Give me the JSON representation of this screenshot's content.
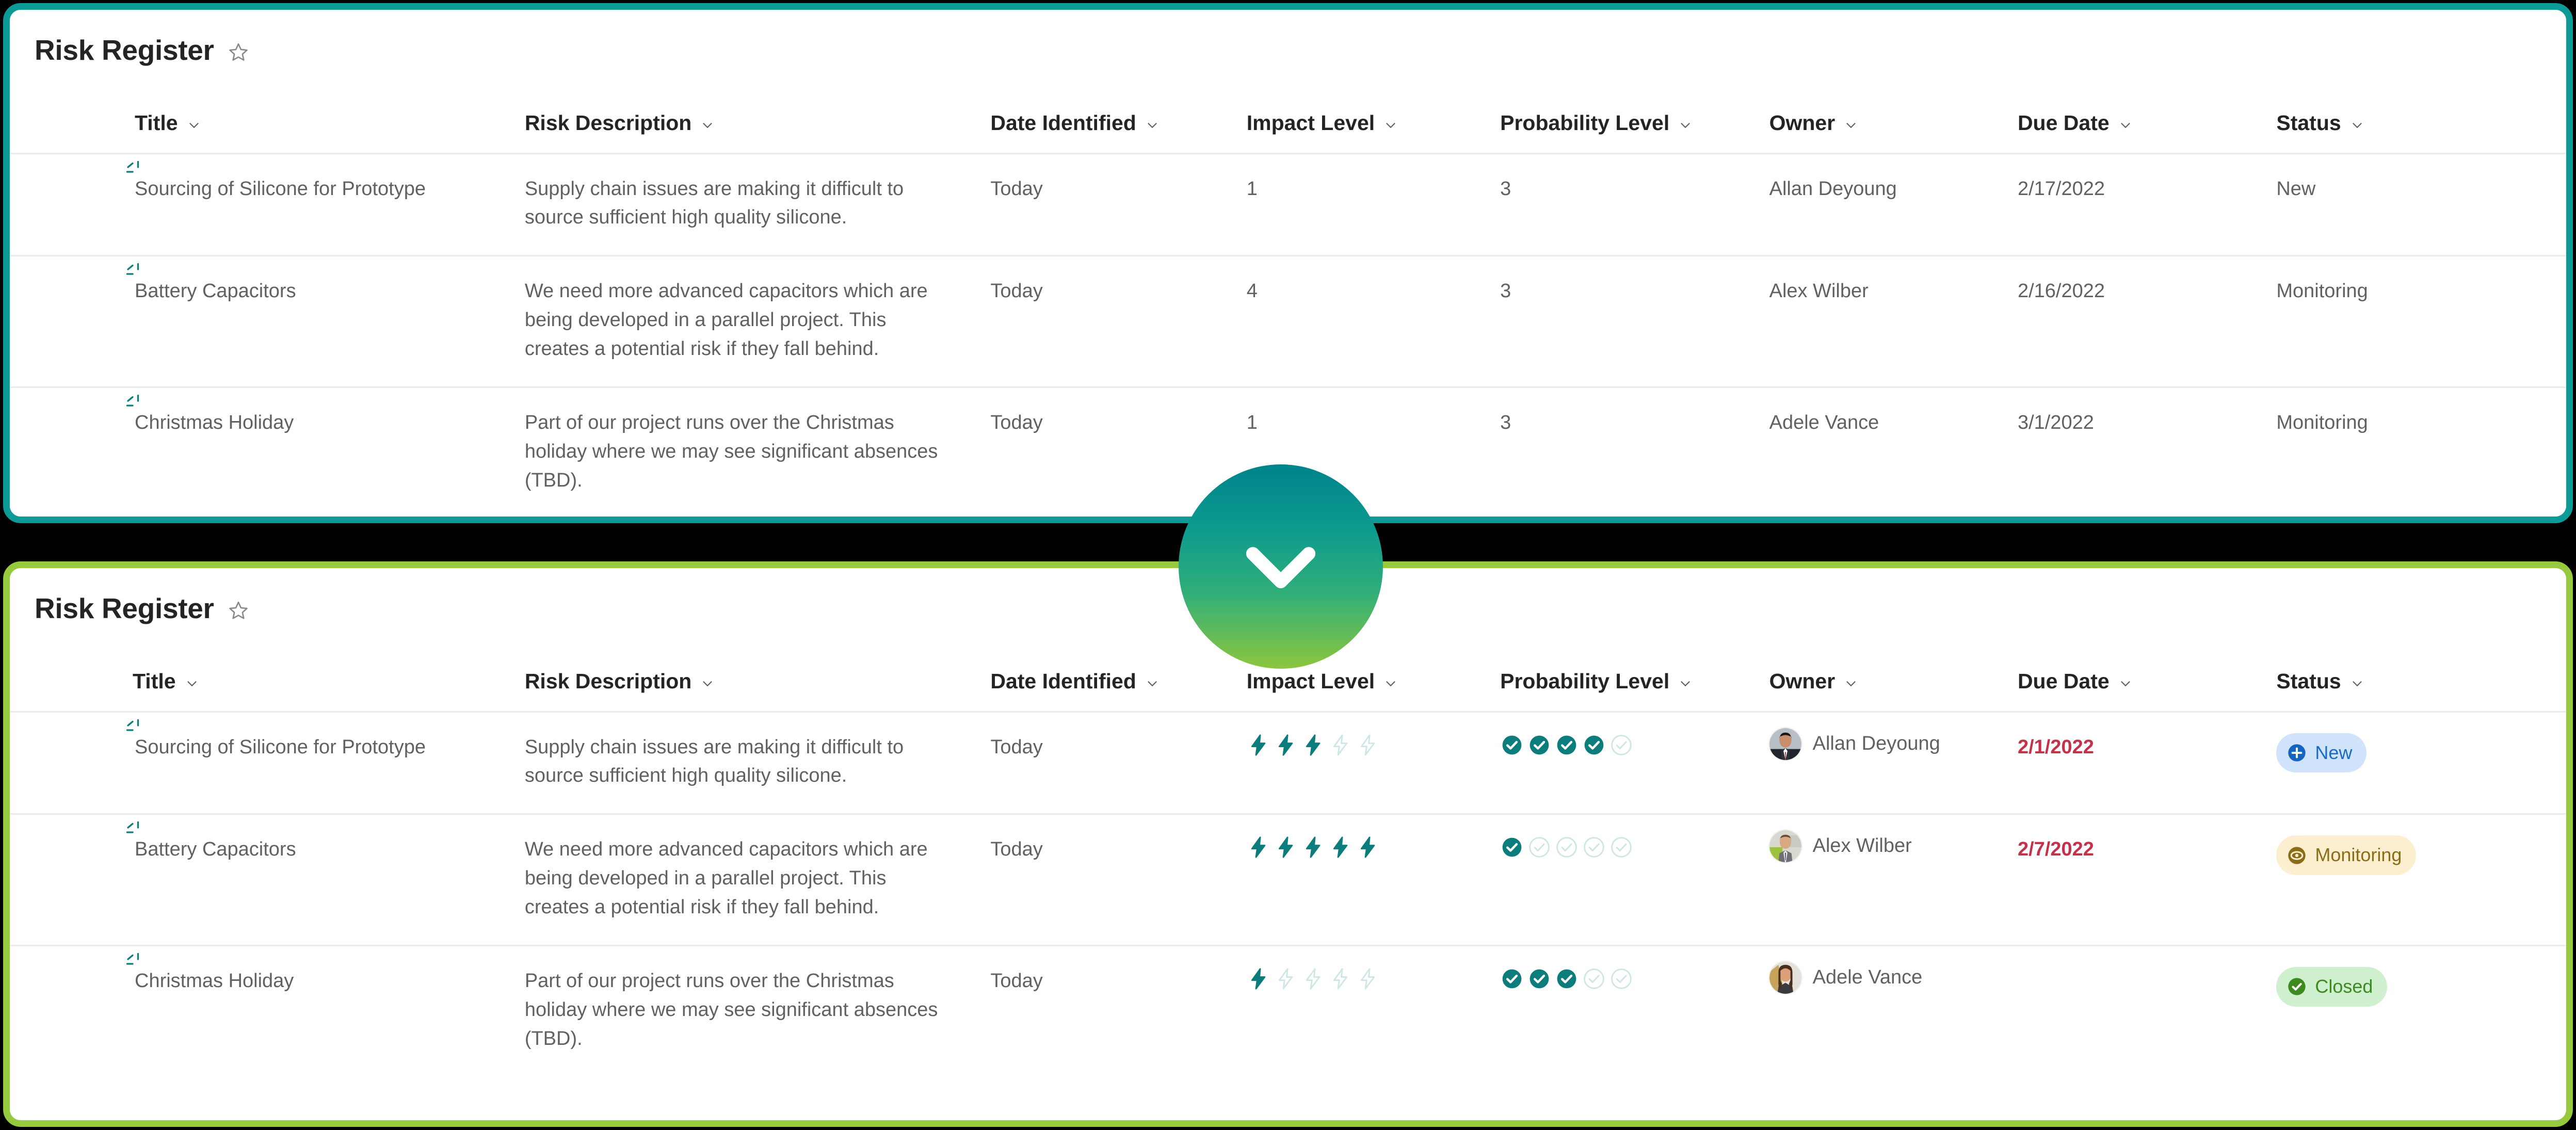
{
  "panels": {
    "top": {
      "title": "Risk Register",
      "border_color": "#0C9B96",
      "favorite_icon": "star-icon"
    },
    "bottom": {
      "title": "Risk Register",
      "border_color": "#96C93D",
      "favorite_icon": "star-icon"
    }
  },
  "columns": [
    {
      "key": "title",
      "label": "Title"
    },
    {
      "key": "desc",
      "label": "Risk Description"
    },
    {
      "key": "date",
      "label": "Date Identified"
    },
    {
      "key": "impact",
      "label": "Impact Level"
    },
    {
      "key": "prob",
      "label": "Probability Level"
    },
    {
      "key": "owner",
      "label": "Owner"
    },
    {
      "key": "due",
      "label": "Due Date"
    },
    {
      "key": "status",
      "label": "Status"
    }
  ],
  "rows_plain": [
    {
      "title": "Sourcing of Silicone for Prototype",
      "desc": "Supply chain issues are making it difficult to source sufficient high quality silicone.",
      "date": "Today",
      "impact": "1",
      "prob": "3",
      "owner": "Allan Deyoung",
      "due": "2/17/2022",
      "status": "New"
    },
    {
      "title": "Battery Capacitors",
      "desc": "We need more advanced capacitors which are being developed in a parallel project. This creates a potential risk if they fall behind.",
      "date": "Today",
      "impact": "4",
      "prob": "3",
      "owner": "Alex Wilber",
      "due": "2/16/2022",
      "status": "Monitoring"
    },
    {
      "title": "Christmas Holiday",
      "desc": "Part of our project runs over the Christmas holiday where we may see significant absences (TBD).",
      "date": "Today",
      "impact": "1",
      "prob": "3",
      "owner": "Adele Vance",
      "due": "3/1/2022",
      "status": "Monitoring"
    }
  ],
  "rows_formatted": [
    {
      "title": "Sourcing of Silicone for Prototype",
      "desc": "Supply chain issues are making it difficult to source sufficient high quality silicone.",
      "date": "Today",
      "impact_filled": 3,
      "impact_total": 5,
      "prob_filled": 4,
      "prob_total": 5,
      "owner": "Allan Deyoung",
      "avatar": "avatar-allan-deyoung",
      "due": "2/1/2022",
      "due_overdue": true,
      "status": "New",
      "status_style": "badge-new",
      "status_icon": "plus-circle-icon"
    },
    {
      "title": "Battery Capacitors",
      "desc": "We need more advanced capacitors which are being developed in a parallel project. This creates a potential risk if they fall behind.",
      "date": "Today",
      "impact_filled": 5,
      "impact_total": 5,
      "prob_filled": 1,
      "prob_total": 5,
      "owner": "Alex Wilber",
      "avatar": "avatar-alex-wilber",
      "due": "2/7/2022",
      "due_overdue": true,
      "status": "Monitoring",
      "status_style": "badge-monitoring",
      "status_icon": "eye-circle-icon"
    },
    {
      "title": "Christmas Holiday",
      "desc": "Part of our project runs over the Christmas holiday where we may see significant absences (TBD).",
      "date": "Today",
      "impact_filled": 1,
      "impact_total": 5,
      "prob_filled": 3,
      "prob_total": 5,
      "owner": "Adele Vance",
      "avatar": "avatar-adele-vance",
      "due": "",
      "due_overdue": false,
      "status": "Closed",
      "status_style": "badge-closed",
      "status_icon": "check-circle-icon"
    }
  ],
  "colors": {
    "accent_teal": "#0C7C7C",
    "accent_teal_light": "#D6EDED",
    "accent_green": "#96C93D",
    "overdue_red": "#C4314B",
    "text_primary": "#242424",
    "text_secondary": "#616161",
    "row_divider": "#EDEBE9"
  },
  "expand_button": {
    "icon": "chevron-down-icon"
  }
}
